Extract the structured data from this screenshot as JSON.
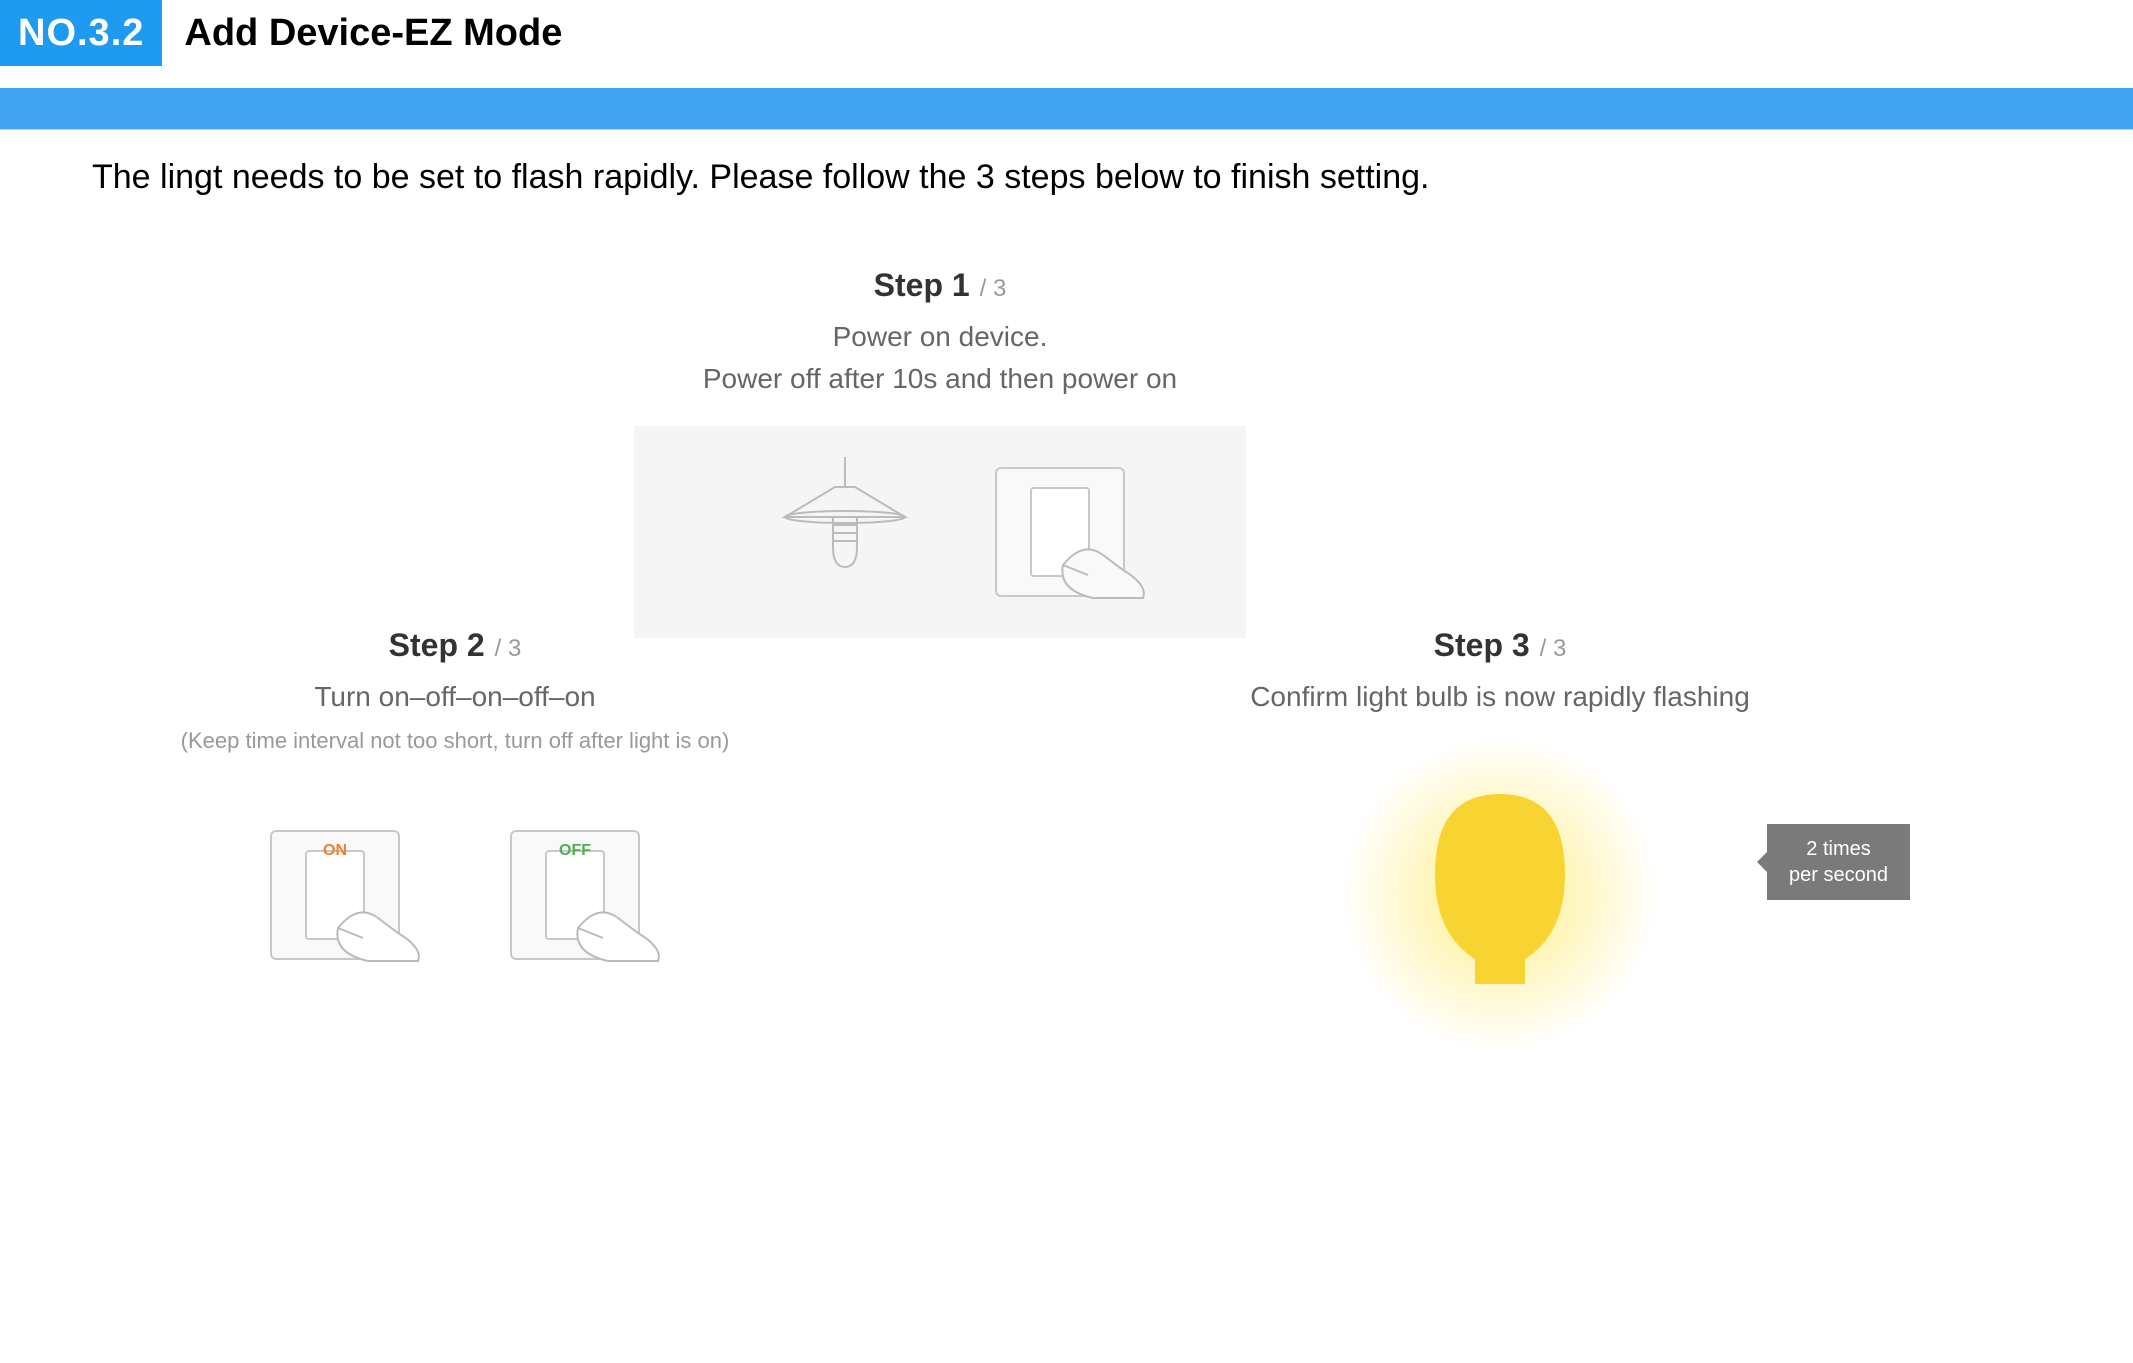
{
  "header": {
    "badge": "NO.3.2",
    "title": "Add Device-EZ Mode"
  },
  "intro": "The lingt needs to be set to flash rapidly. Please follow the 3 steps below to finish setting.",
  "steps": {
    "s1": {
      "head": "Step 1",
      "sub": "/ 3",
      "line1": "Power on device.",
      "line2": "Power off after 10s and then power on"
    },
    "s2": {
      "head": "Step 2",
      "sub": "/ 3",
      "line1": "Turn on–off–on–off–on",
      "note": "(Keep time interval not too short, turn off after light is on)",
      "on_label": "ON",
      "off_label": "OFF"
    },
    "s3": {
      "head": "Step 3",
      "sub": "/ 3",
      "line1": "Confirm light bulb is now rapidly flashing",
      "callout_l1": "2 times",
      "callout_l2": "per second"
    }
  }
}
